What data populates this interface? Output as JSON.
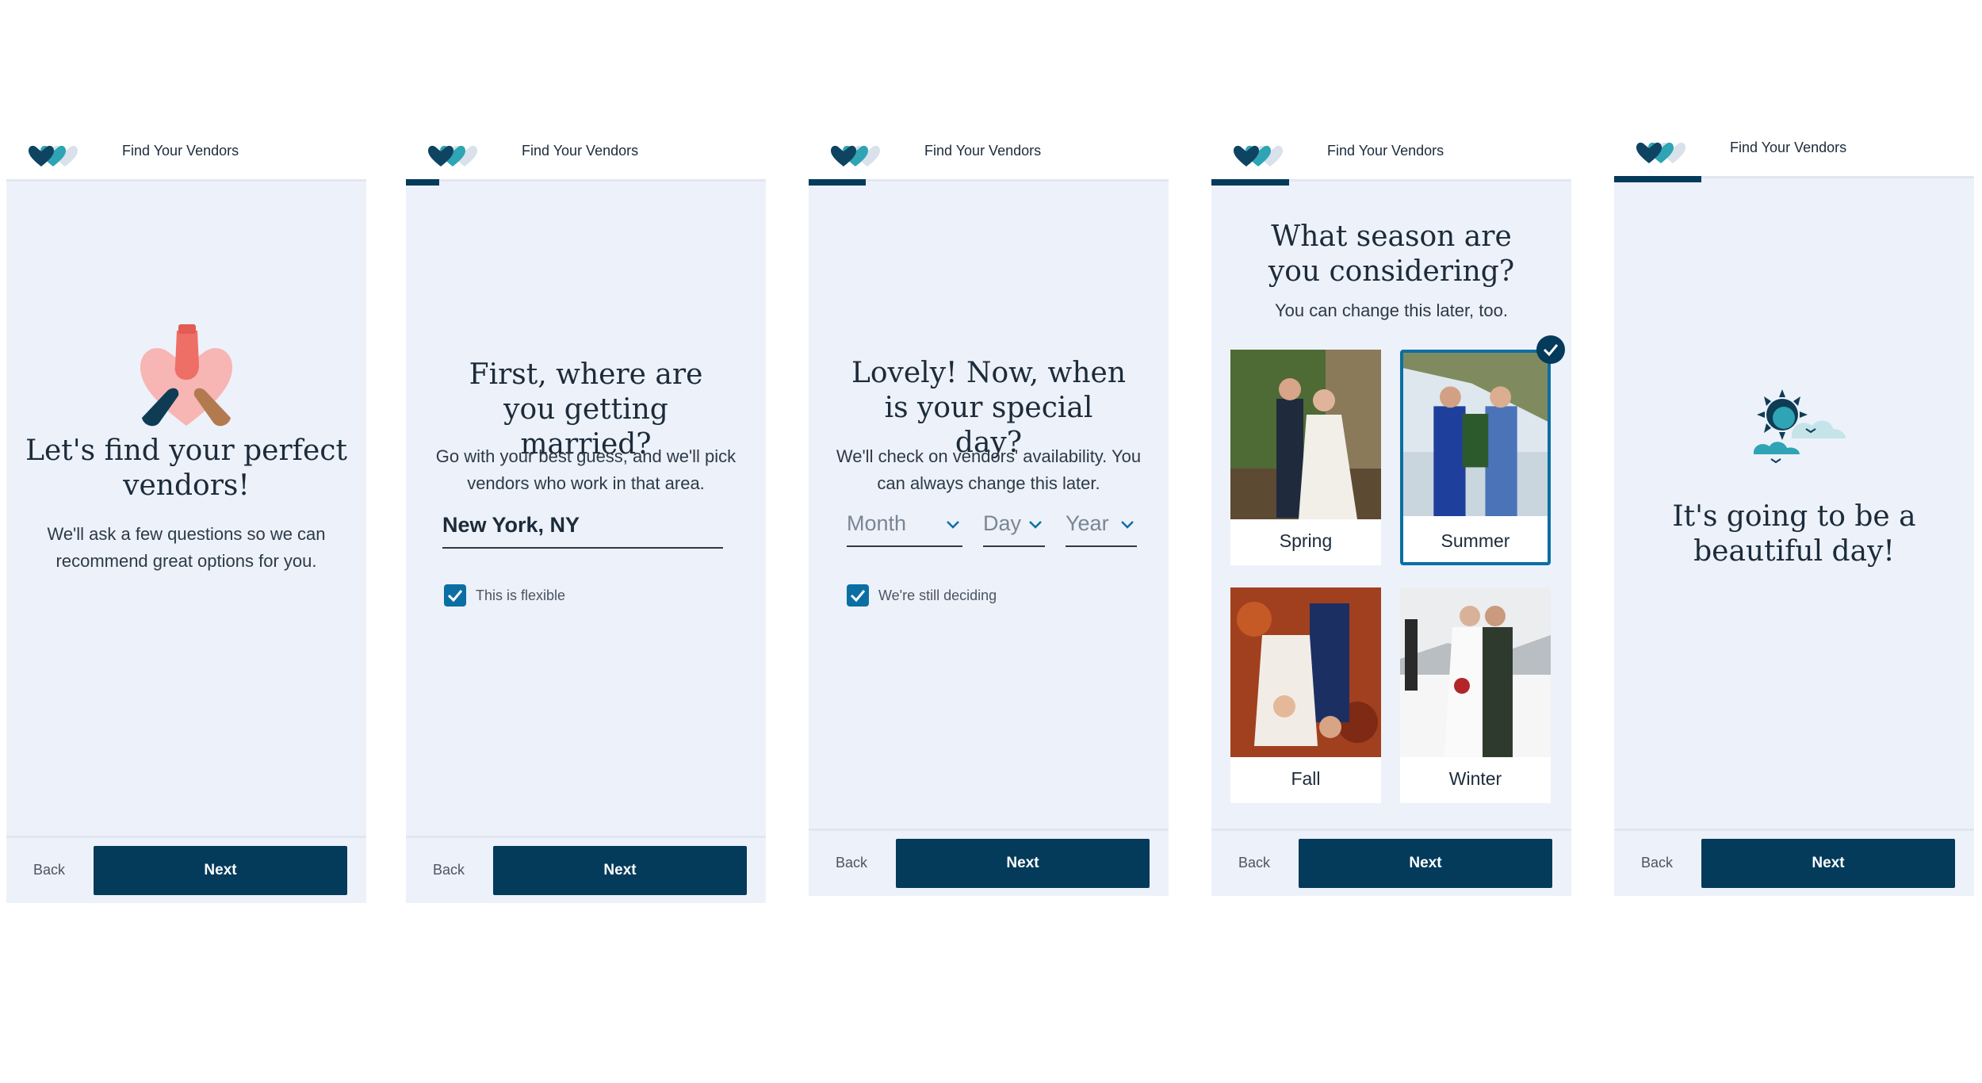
{
  "header_title": "Find Your Vendors",
  "back_label": "Back",
  "next_label": "Next",
  "colors": {
    "navy": "#043a5a",
    "accent": "#0b6fa3",
    "panel": "#edf1f9"
  },
  "screen1": {
    "title": "Let's find your perfect vendors!",
    "subtitle": "We'll ask a few questions so we can recommend great options for you.",
    "icon": "hands-heart-icon"
  },
  "screen2": {
    "title": "First, where are you getting married?",
    "subtitle": "Go with your best guess, and we'll pick vendors who work in that area.",
    "location_value": "New York, NY",
    "flexible_label": "This is flexible",
    "flexible_checked": true
  },
  "screen3": {
    "title": "Lovely! Now, when is your special day?",
    "subtitle": "We'll check on vendors' availability. You can always change this later.",
    "month_placeholder": "Month",
    "day_placeholder": "Day",
    "year_placeholder": "Year",
    "deciding_label": "We're still deciding",
    "deciding_checked": true
  },
  "screen4": {
    "title": "What season are you considering?",
    "subtitle": "You can change this later, too.",
    "seasons": [
      "Spring",
      "Summer",
      "Fall",
      "Winter"
    ],
    "selected": "Summer"
  },
  "screen5": {
    "title": "It's going to be a beautiful day!",
    "icon": "sun-cloud-icon"
  }
}
